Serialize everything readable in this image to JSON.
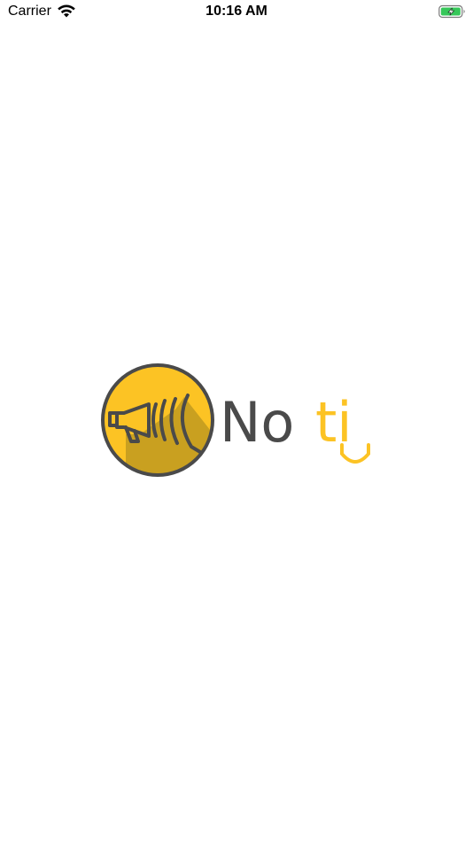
{
  "status_bar": {
    "carrier": "Carrier",
    "time": "10:16 AM",
    "wifi_icon": "wifi-icon",
    "battery_icon": "battery-charging-icon",
    "battery_color": "#36c759"
  },
  "splash": {
    "logo_icon": "megaphone-icon",
    "wordmark": {
      "part1": "No",
      "part2": "ti"
    },
    "colors": {
      "yellow": "#fcc324",
      "yellow_shadow": "#c9a020",
      "dark": "#4a4a4a"
    }
  }
}
